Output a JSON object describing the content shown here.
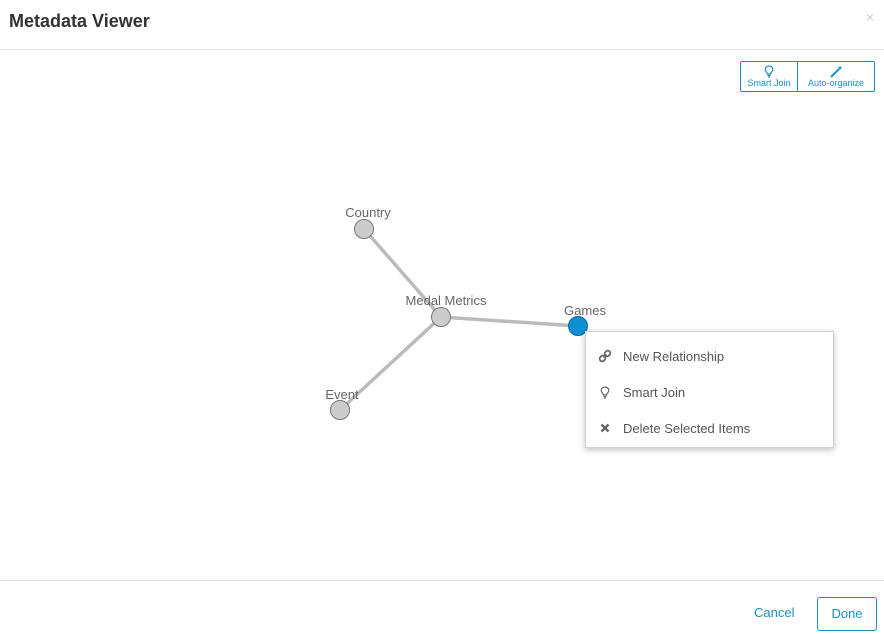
{
  "dialog": {
    "title": "Metadata Viewer",
    "close_symbol": "×"
  },
  "toolbar": {
    "smart_join_label": "Smart Join",
    "smart_join_icon": "lightbulb-icon",
    "auto_organize_label": "Auto-organize",
    "auto_organize_icon": "magic-wand-icon"
  },
  "graph": {
    "nodes": [
      {
        "id": "country",
        "label": "Country",
        "selected": false
      },
      {
        "id": "medal-metrics",
        "label": "Medal Metrics",
        "selected": false
      },
      {
        "id": "games",
        "label": "Games",
        "selected": true
      },
      {
        "id": "event",
        "label": "Event",
        "selected": false
      }
    ],
    "edges": [
      {
        "from": "country",
        "to": "medal-metrics"
      },
      {
        "from": "medal-metrics",
        "to": "games"
      },
      {
        "from": "medal-metrics",
        "to": "event"
      }
    ],
    "colors": {
      "node_fill": "#cccccc",
      "node_stroke": "#777777",
      "selected_fill": "#0e8fd4",
      "selected_stroke": "#0a6aa0",
      "edge": "#bbbbbb"
    }
  },
  "context_menu": {
    "items": [
      {
        "label": "New Relationship",
        "icon": "link-icon"
      },
      {
        "label": "Smart Join",
        "icon": "lightbulb-icon"
      },
      {
        "label": "Delete Selected Items",
        "icon": "close-icon"
      }
    ]
  },
  "footer": {
    "cancel_label": "Cancel",
    "done_label": "Done"
  }
}
